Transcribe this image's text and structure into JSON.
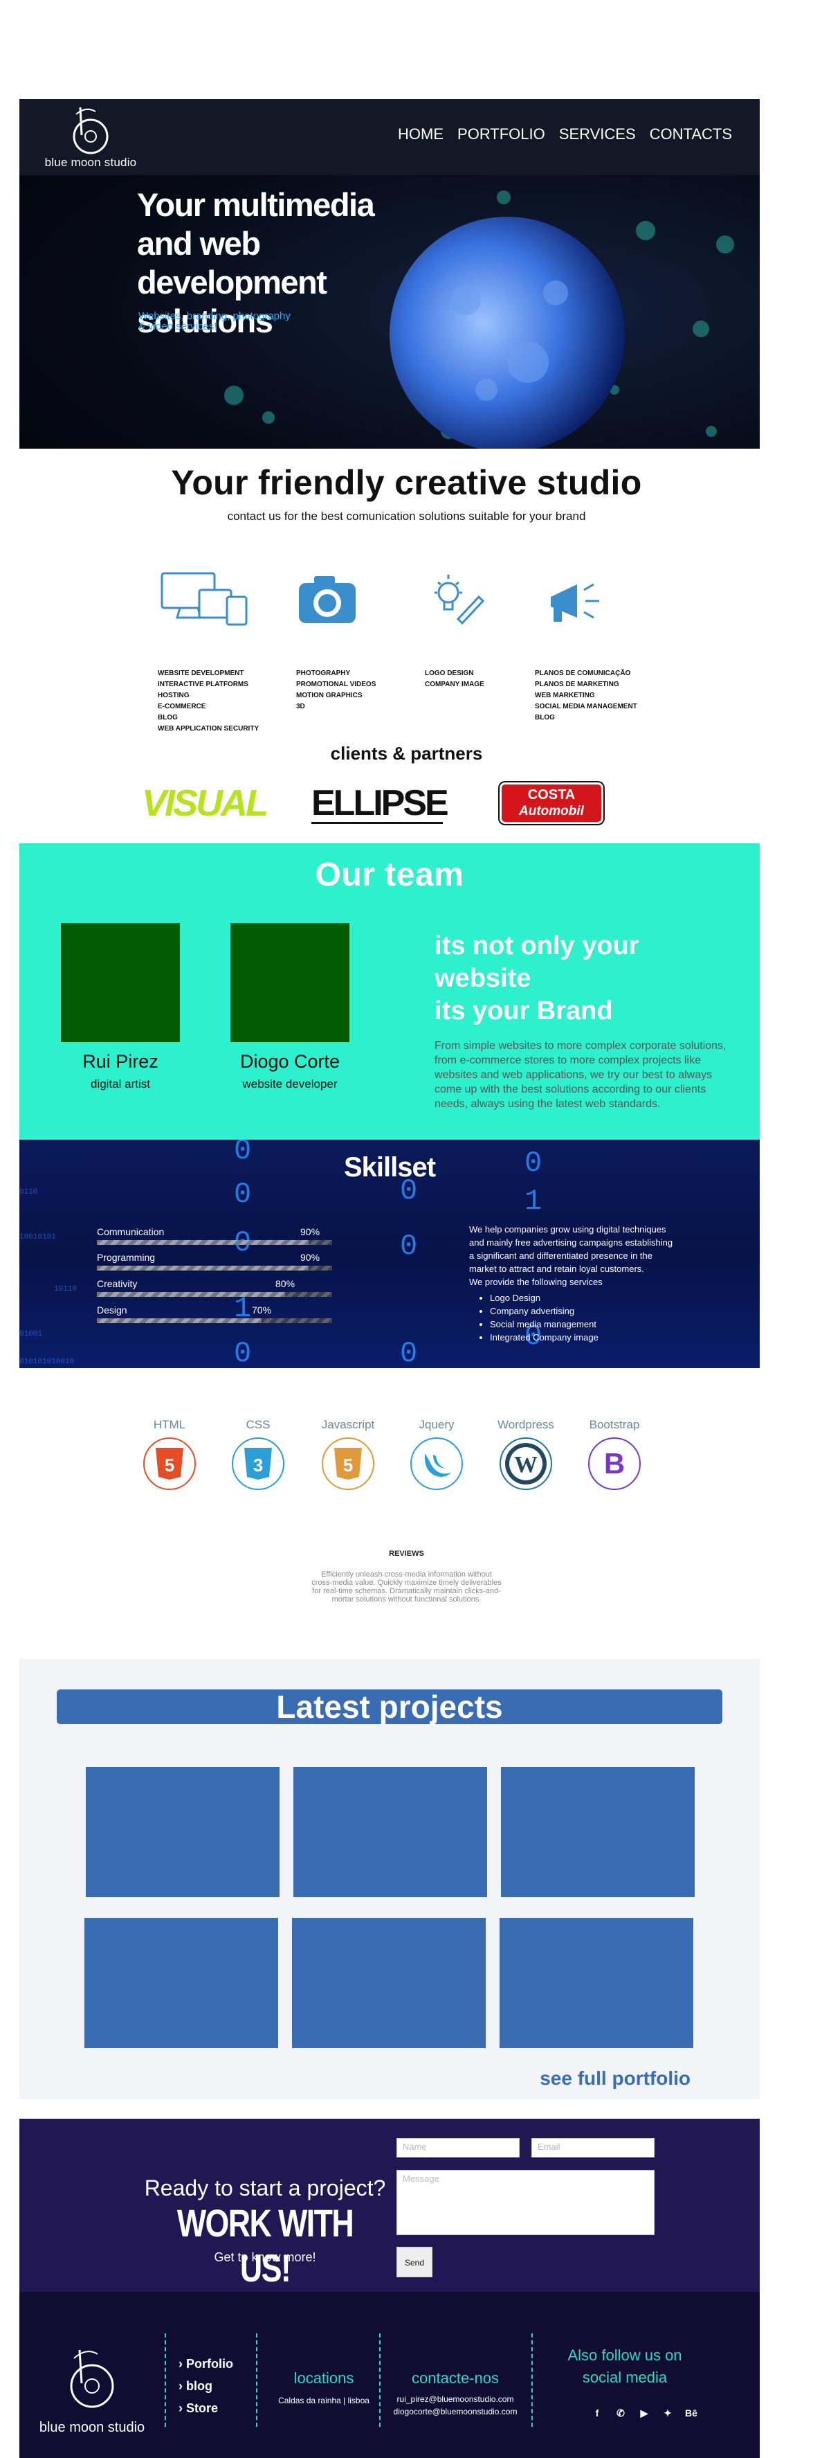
{
  "header": {
    "brand": "blue moon studio",
    "nav": [
      "HOME",
      "PORTFOLIO",
      "SERVICES",
      "CONTACTS"
    ]
  },
  "hero": {
    "title": "Your multimedia and web development solutions",
    "subtitle": "Websites, branding, photography & video services!"
  },
  "intro": {
    "title": "Your friendly creative studio",
    "subtitle": "contact us for the best comunication solutions suitable for your brand"
  },
  "services": [
    {
      "icon": "devices-icon",
      "items": [
        "WEBSITE DEVELOPMENT",
        "INTERACTIVE PLATFORMS",
        "HOSTING",
        "E-COMMERCE",
        "BLOG",
        "WEB APPLICATION SECURITY"
      ]
    },
    {
      "icon": "camera-icon",
      "items": [
        "PHOTOGRAPHY",
        "PROMOTIONAL VIDEOS",
        "MOTION GRAPHICS",
        "3D"
      ]
    },
    {
      "icon": "lightbulb-pencil-icon",
      "items": [
        "LOGO DESIGN",
        "COMPANY IMAGE"
      ]
    },
    {
      "icon": "megaphone-icon",
      "items": [
        "PLANOS DE COMUNICAÇÃO",
        "PLANOS DE MARKETING",
        "WEB MARKETING",
        "SOCIAL MEDIA MANAGEMENT",
        "BLOG"
      ]
    }
  ],
  "partners": {
    "title": "clients & partners",
    "logos": [
      "VISUAL",
      "ELLIPSE",
      "COSTA",
      "Automobil"
    ]
  },
  "team": {
    "title": "Our team",
    "members": [
      {
        "name": "Rui Pirez",
        "role": "digital artist"
      },
      {
        "name": "Diogo Corte",
        "role": "website developer"
      }
    ],
    "headline": [
      "its not only your",
      "website",
      "its your Brand"
    ],
    "paragraph": "From simple websites to more complex corporate solutions, from e-commerce stores to more complex projects like websites and web applications, we try our best to always come up  with the best solutions according to our clients needs, always using the latest web standards."
  },
  "skills": {
    "title": "Skillset",
    "items": [
      {
        "label": "Communication",
        "pct_label": "90%",
        "value": 0.9
      },
      {
        "label": "Programming",
        "pct_label": "90%",
        "value": 0.9
      },
      {
        "label": "Creativity",
        "pct_label": "80%",
        "value": 0.8
      },
      {
        "label": "Design",
        "pct_label": "70%",
        "value": 0.7
      }
    ],
    "intro": "We help companies grow using digital techniques and mainly free advertising campaigns establishing a significant and differentiated presence in the market to attract and retain loyal customers.",
    "provide": "We provide the following services",
    "list": [
      "Logo Design",
      "Company advertising",
      "Social media management",
      "Integrated Company image"
    ]
  },
  "tech": [
    {
      "label": "HTML",
      "glyph": "5",
      "color": "#e44d26",
      "icon": "html5-icon"
    },
    {
      "label": "CSS",
      "glyph": "3",
      "color": "#2a9fd8",
      "icon": "css3-icon"
    },
    {
      "label": "Javascript",
      "glyph": "5",
      "color": "#e09a3b",
      "icon": "javascript-icon"
    },
    {
      "label": "Jquery",
      "glyph": "◠",
      "color": "#2a9fd8",
      "icon": "jquery-icon"
    },
    {
      "label": "Wordpress",
      "glyph": "W",
      "color": "#21759b",
      "icon": "wordpress-icon"
    },
    {
      "label": "Bootstrap",
      "glyph": "B",
      "color": "#7a35cc",
      "icon": "bootstrap-icon"
    }
  ],
  "reviews": {
    "title": "REVIEWS",
    "body": "Efficiently unleash cross-media information without cross-media value. Quickly maximize timely deliverables for real-time schemas. Dramatically maintain clicks-and-mortar solutions without functional solutions."
  },
  "projects": {
    "title": "Latest projects",
    "link": "see full portfolio"
  },
  "cta": {
    "question": "Ready to start a project?",
    "headline": "WORK WITH US!",
    "small": "Get to know more!",
    "name_placeholder": "Name",
    "email_placeholder": "Email",
    "message_placeholder": "Message",
    "send": "Send"
  },
  "footer": {
    "brand": "blue moon studio",
    "links": [
      "Porfolio",
      "blog",
      "Store"
    ],
    "locations_title": "locations",
    "locations_text": "Caldas da rainha | lisboa",
    "contact_title": "contacte-nos",
    "emails": [
      "rui_pirez@bluemoonstudio.com",
      "diogocorte@bluemoonstudio.com"
    ],
    "follow": [
      "Also follow us on",
      "social media"
    ],
    "social": [
      "facebook-icon",
      "whatsapp-icon",
      "youtube-icon",
      "twitter-icon",
      "behance-icon"
    ]
  },
  "colors": {
    "team_bg": "#2df0cd",
    "project_blue": "#396cb3",
    "cta_bg": "#201753",
    "footer_bg": "#110d32",
    "accent_teal": "#2bd9c4"
  }
}
